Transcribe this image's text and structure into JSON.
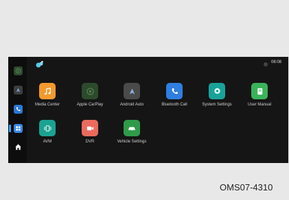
{
  "status": {
    "time": "08:08"
  },
  "sidebar": {
    "items": [
      {
        "icon": "carplay-icon",
        "color": "#2f4a2e"
      },
      {
        "icon": "android-auto-icon",
        "color": "#3d3d3d"
      },
      {
        "icon": "phone-icon",
        "color": "#2a78d6"
      },
      {
        "icon": "apps-grid-icon",
        "color": "#3a87e8",
        "selected": true
      },
      {
        "icon": "home-icon",
        "color": "#ffffff"
      }
    ]
  },
  "apps": [
    {
      "label": "Media Center",
      "icon": "music-note-icon",
      "color": "#f29a2e"
    },
    {
      "label": "Apple CarPlay",
      "icon": "carplay-play-icon",
      "color": "#2d4a2c"
    },
    {
      "label": "Android Auto",
      "icon": "android-auto-icon",
      "color": "#4a4a4a"
    },
    {
      "label": "Bluetooth Call",
      "icon": "phone-icon",
      "color": "#2f7ee0"
    },
    {
      "label": "System Settings",
      "icon": "gear-icon",
      "color": "#18a39a"
    },
    {
      "label": "User Manual",
      "icon": "book-icon",
      "color": "#3ab35a"
    },
    {
      "label": "AVM",
      "icon": "camera-360-icon",
      "color": "#1aa391"
    },
    {
      "label": "DVR",
      "icon": "dvr-camera-icon",
      "color": "#ea6a5e"
    },
    {
      "label": "Vehicle Settings",
      "icon": "car-icon",
      "color": "#2f9a4a"
    }
  ],
  "caption": "OMS07-4310"
}
